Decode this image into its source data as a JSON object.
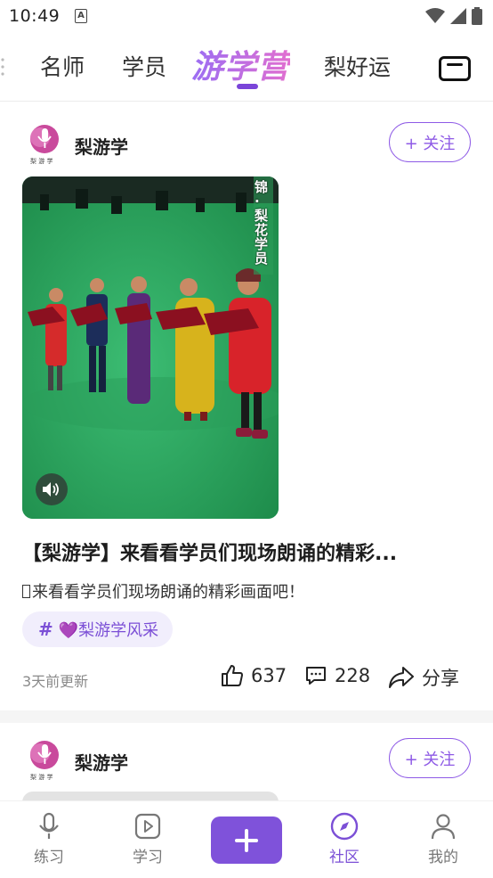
{
  "status_bar": {
    "time": "10:49",
    "notification_letter": "A"
  },
  "top_tabs": {
    "items": [
      "名师",
      "学员",
      "游学营",
      "梨好运"
    ],
    "active": "游学营"
  },
  "posts": [
    {
      "author": "梨游学",
      "follow_label": "+ 关注",
      "title": "【梨游学】来看看学员们现场朗诵的精彩...",
      "description": "来看看学员们现场朗诵的精彩画面吧！",
      "topic": "💜梨游学风采",
      "updated": "3天前更新",
      "likes": "637",
      "comments": "228",
      "share_label": "分享",
      "video_overlay_text": "锦·梨花学员"
    },
    {
      "author": "梨游学",
      "follow_label": "+ 关注"
    }
  ],
  "avatar_caption": "梨 游 学",
  "bottom_nav": {
    "items": [
      {
        "label": "练习",
        "icon": "microphone-icon"
      },
      {
        "label": "学习",
        "icon": "play-square-icon"
      },
      {
        "label": "社区",
        "icon": "compass-icon"
      },
      {
        "label": "我的",
        "icon": "person-icon"
      }
    ],
    "active": "社区"
  },
  "colors": {
    "accent": "#7f52da",
    "active_tab_gradient": [
      "#9b6ef3",
      "#e16fd0"
    ],
    "chip_bg": "#f1eefc"
  }
}
